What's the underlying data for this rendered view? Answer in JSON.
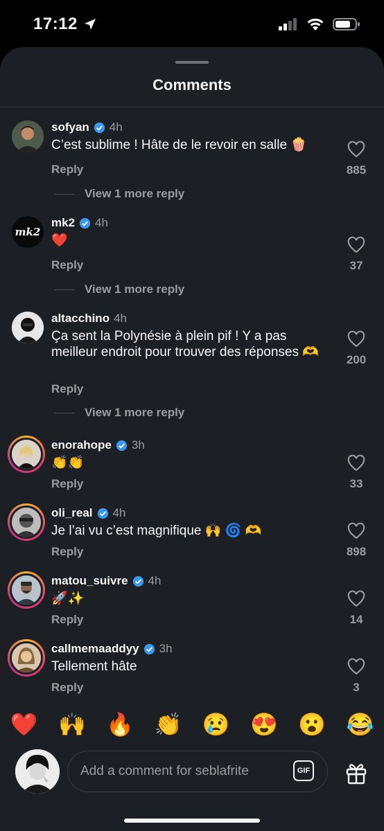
{
  "status_bar": {
    "time": "17:12"
  },
  "sheet": {
    "title": "Comments"
  },
  "comments": [
    {
      "username": "sofyan",
      "verified": true,
      "time": "4h",
      "text": "C’est sublime ! Hâte de le revoir en salle 🍿",
      "reply_label": "Reply",
      "likes": "885",
      "view_more": "View 1 more reply"
    },
    {
      "username": "mk2",
      "verified": true,
      "time": "4h",
      "text": "❤️",
      "reply_label": "Reply",
      "likes": "37",
      "view_more": "View 1 more reply",
      "avatar_text": "mk2"
    },
    {
      "username": "altacchino",
      "verified": false,
      "time": "4h",
      "text": "Ça sent la Polynésie à plein pif ! Y a pas meilleur endroit pour trouver des réponses 🫶",
      "reply_label": "Reply",
      "likes": "200",
      "view_more": "View 1 more reply"
    },
    {
      "username": "enorahope",
      "verified": true,
      "time": "3h",
      "text": "👏👏",
      "reply_label": "Reply",
      "likes": "33"
    },
    {
      "username": "oli_real",
      "verified": true,
      "time": "4h",
      "text": "Je l’ai vu c’est magnifique 🙌 🌀 🫶",
      "reply_label": "Reply",
      "likes": "898"
    },
    {
      "username": "matou_suivre",
      "verified": true,
      "time": "4h",
      "text": "🚀✨",
      "reply_label": "Reply",
      "likes": "14"
    },
    {
      "username": "callmemaaddyy",
      "verified": true,
      "time": "3h",
      "text": "Tellement hâte",
      "reply_label": "Reply",
      "likes": "3"
    }
  ],
  "emoji_bar": [
    "❤️",
    "🙌",
    "🔥",
    "👏",
    "😢",
    "😍",
    "😮",
    "😂"
  ],
  "composer": {
    "placeholder": "Add a comment for seblafrite",
    "gif_label": "GIF"
  },
  "colors": {
    "sheet_bg": "#1c1f24",
    "verified_blue": "#3897f0",
    "muted_text": "#9a9ea4",
    "heart_red": "#e0245e"
  }
}
